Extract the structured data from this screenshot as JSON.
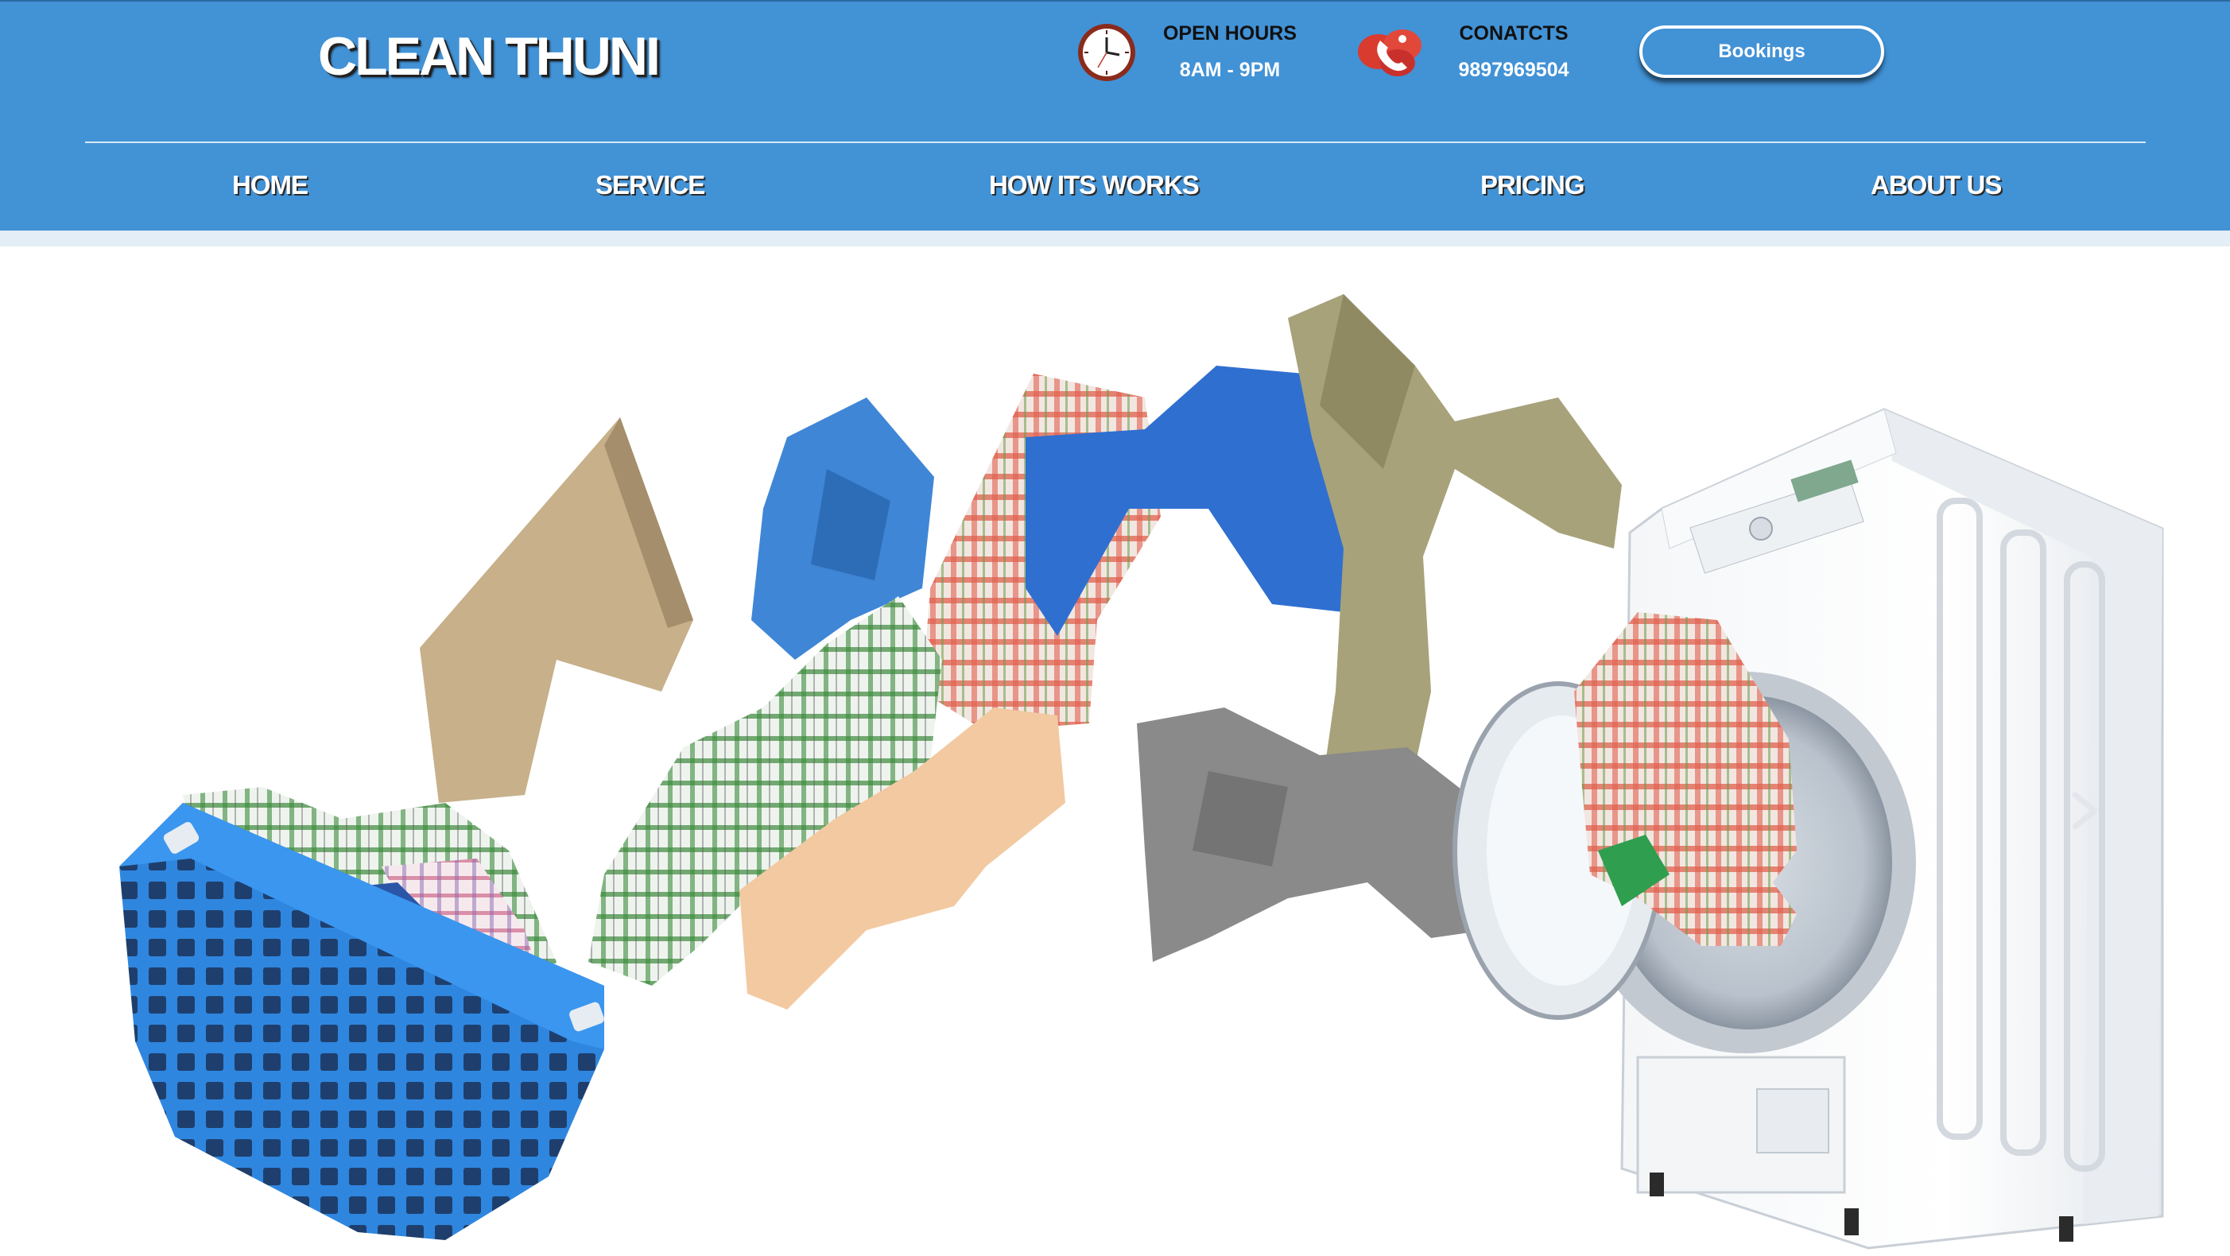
{
  "brand": {
    "name": "CLEAN THUNI"
  },
  "header": {
    "hours": {
      "title": "OPEN HOURS",
      "value": "8AM - 9PM",
      "icon": "clock-icon"
    },
    "contacts": {
      "title": "CONATCTS",
      "value": "9897969504",
      "icon": "phone-icon"
    },
    "bookings_label": "Bookings"
  },
  "nav": {
    "items": [
      {
        "label": "HOME"
      },
      {
        "label": "SERVICE"
      },
      {
        "label": "HOW ITS WORKS"
      },
      {
        "label": "PRICING"
      },
      {
        "label": "ABOUT US"
      }
    ]
  },
  "hero": {
    "next_icon": "chevron-right-icon"
  },
  "colors": {
    "header_bg": "#4292d6",
    "strip": "#e3eef6",
    "basket": "#3a8ee6"
  }
}
